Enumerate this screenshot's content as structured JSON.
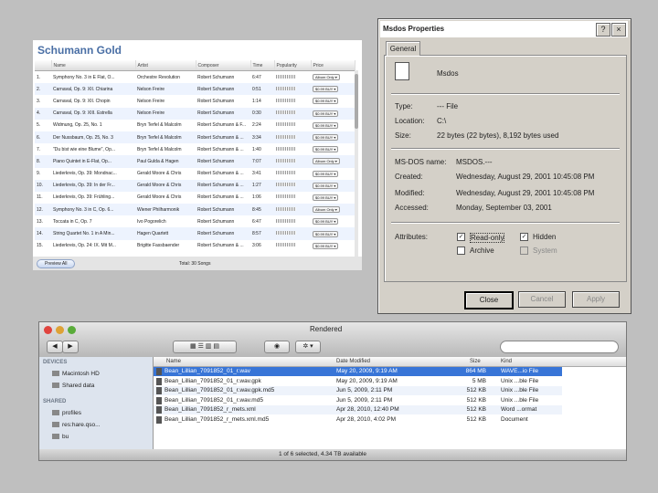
{
  "itunes": {
    "title": "Schumann Gold",
    "columns": [
      "",
      "Name",
      "Artist",
      "Composer",
      "Time",
      "Popularity",
      "Price"
    ],
    "rows": [
      {
        "num": "1.",
        "name": "Symphony No. 3 in E Flat, O...",
        "artist": "Orchestre Revolution",
        "composer": "Robert Schumann",
        "time": "6:47",
        "price": "Album Only ▾"
      },
      {
        "num": "2.",
        "name": "Carnaval, Op. 9: XII. Chiarina",
        "artist": "Nelson Freire",
        "composer": "Robert Schumann",
        "time": "0:51",
        "price": "$0.99 BUY ▾"
      },
      {
        "num": "3.",
        "name": "Carnaval, Op. 9: XII. Chopin",
        "artist": "Nelson Freire",
        "composer": "Robert Schumann",
        "time": "1:14",
        "price": "$0.99 BUY ▾"
      },
      {
        "num": "4.",
        "name": "Carnaval, Op. 9: XIII. Estrella",
        "artist": "Nelson Freire",
        "composer": "Robert Schumann",
        "time": "0:30",
        "price": "$0.99 BUY ▾"
      },
      {
        "num": "5.",
        "name": "Widmung, Op. 25, No. 1",
        "artist": "Bryn Terfel & Malcolm",
        "composer": "Robert Schumann & F...",
        "time": "2:24",
        "price": "$0.99 BUY ▾"
      },
      {
        "num": "6.",
        "name": "Der Nussbaum, Op. 25, No. 3",
        "artist": "Bryn Terfel & Malcolm",
        "composer": "Robert Schumann & ...",
        "time": "3:34",
        "price": "$0.99 BUY ▾"
      },
      {
        "num": "7.",
        "name": "\"Du bist wie eine Blume\", Op...",
        "artist": "Bryn Terfel & Malcolm",
        "composer": "Robert Schumann & ...",
        "time": "1:40",
        "price": "$0.99 BUY ▾"
      },
      {
        "num": "8.",
        "name": "Piano Quintet in E-Flat, Op...",
        "artist": "Paul Gulda & Hagen",
        "composer": "Robert Schumann",
        "time": "7:07",
        "price": "Album Only ▾"
      },
      {
        "num": "9.",
        "name": "Liederkreis, Op. 39: Mondnac...",
        "artist": "Gerald Moore & Chris",
        "composer": "Robert Schumann & ...",
        "time": "3:41",
        "price": "$0.99 BUY ▾"
      },
      {
        "num": "10.",
        "name": "Liederkreis, Op. 39: In der Fr...",
        "artist": "Gerald Moore & Chris",
        "composer": "Robert Schumann & ...",
        "time": "1:27",
        "price": "$0.99 BUY ▾"
      },
      {
        "num": "11.",
        "name": "Liederkreis, Op. 39: Frühling...",
        "artist": "Gerald Moore & Chris",
        "composer": "Robert Schumann & ...",
        "time": "1:06",
        "price": "$0.99 BUY ▾"
      },
      {
        "num": "12.",
        "name": "Symphony No. 3 in C, Op. 6...",
        "artist": "Wiener Philharmonik",
        "composer": "Robert Schumann",
        "time": "8:45",
        "price": "Album Only ▾"
      },
      {
        "num": "13.",
        "name": "Toccata in C, Op. 7",
        "artist": "Ivo Pogorelich",
        "composer": "Robert Schumann",
        "time": "6:47",
        "price": "$0.99 BUY ▾"
      },
      {
        "num": "14.",
        "name": "String Quartet No. 1 in A Min...",
        "artist": "Hagen Quartett",
        "composer": "Robert Schumann",
        "time": "8:57",
        "price": "$0.99 BUY ▾"
      },
      {
        "num": "15.",
        "name": "Liederkreis, Op. 24: IX. Mit M...",
        "artist": "Brigitte Fassbaender",
        "composer": "Robert Schumann & ...",
        "time": "3:06",
        "price": "$0.99 BUY ▾"
      }
    ],
    "preview_label": "Preview All",
    "total": "Total: 30 Songs"
  },
  "props": {
    "window_title": "Msdos Properties",
    "help_btn": "?",
    "close_btn": "×",
    "tab": "General",
    "file_name": "Msdos",
    "labels": {
      "type": "Type:",
      "location": "Location:",
      "size": "Size:",
      "msdos_name": "MS-DOS name:",
      "created": "Created:",
      "modified": "Modified:",
      "accessed": "Accessed:",
      "attributes": "Attributes:"
    },
    "values": {
      "type": "--- File",
      "location": "C:\\",
      "size": "22 bytes (22 bytes), 8,192 bytes used",
      "msdos_name": "MSDOS.---",
      "created": "Wednesday, August 29, 2001 10:45:08 PM",
      "modified": "Wednesday, August 29, 2001 10:45:08 PM",
      "accessed": "Monday, September 03, 2001"
    },
    "attrs": {
      "readonly": "Read-only",
      "hidden": "Hidden",
      "archive": "Archive",
      "system": "System"
    },
    "buttons": {
      "close": "Close",
      "cancel": "Cancel",
      "apply": "Apply"
    }
  },
  "finder": {
    "title": "Rendered",
    "sidebar": {
      "devices_head": "DEVICES",
      "devices": [
        "Macintosh HD",
        "Shared data"
      ],
      "shared_head": "SHARED",
      "shared": [
        "profiles",
        "res:hare.qso...",
        "bu"
      ]
    },
    "columns": {
      "name": "Name",
      "date": "Date Modified",
      "size": "Size",
      "kind": "Kind"
    },
    "files": [
      {
        "name": "Bean_Lillian_7091852_01_r.wav",
        "date": "May 20, 2009, 9:19 AM",
        "size": "864 MB",
        "kind": "WAVE...io File"
      },
      {
        "name": "Bean_Lillian_7091852_01_r.wav.gpk",
        "date": "May 20, 2009, 9:19 AM",
        "size": "5 MB",
        "kind": "Unix ...ble File"
      },
      {
        "name": "Bean_Lillian_7091852_01_r.wav.gpk.md5",
        "date": "Jun 5, 2009, 2:11 PM",
        "size": "512 KB",
        "kind": "Unix ...ble File"
      },
      {
        "name": "Bean_Lillian_7091852_01_r.wav.md5",
        "date": "Jun 5, 2009, 2:11 PM",
        "size": "512 KB",
        "kind": "Unix ...ble File"
      },
      {
        "name": "Bean_Lillian_7091852_r_mets.xml",
        "date": "Apr 28, 2010, 12:40 PM",
        "size": "512 KB",
        "kind": "Word ...ormat"
      },
      {
        "name": "Bean_Lillian_7091852_r_mets.xml.md5",
        "date": "Apr 28, 2010, 4:02 PM",
        "size": "512 KB",
        "kind": "Document"
      }
    ],
    "status": "1 of 6 selected, 4.34 TB available",
    "nav_back": "◀",
    "nav_fwd": "▶",
    "eye": "◉",
    "gear": "✲ ▾"
  },
  "colors": {
    "selection": "#3875d7",
    "itunes_title": "#4a6fa5",
    "win_face": "#d4d0c8"
  }
}
